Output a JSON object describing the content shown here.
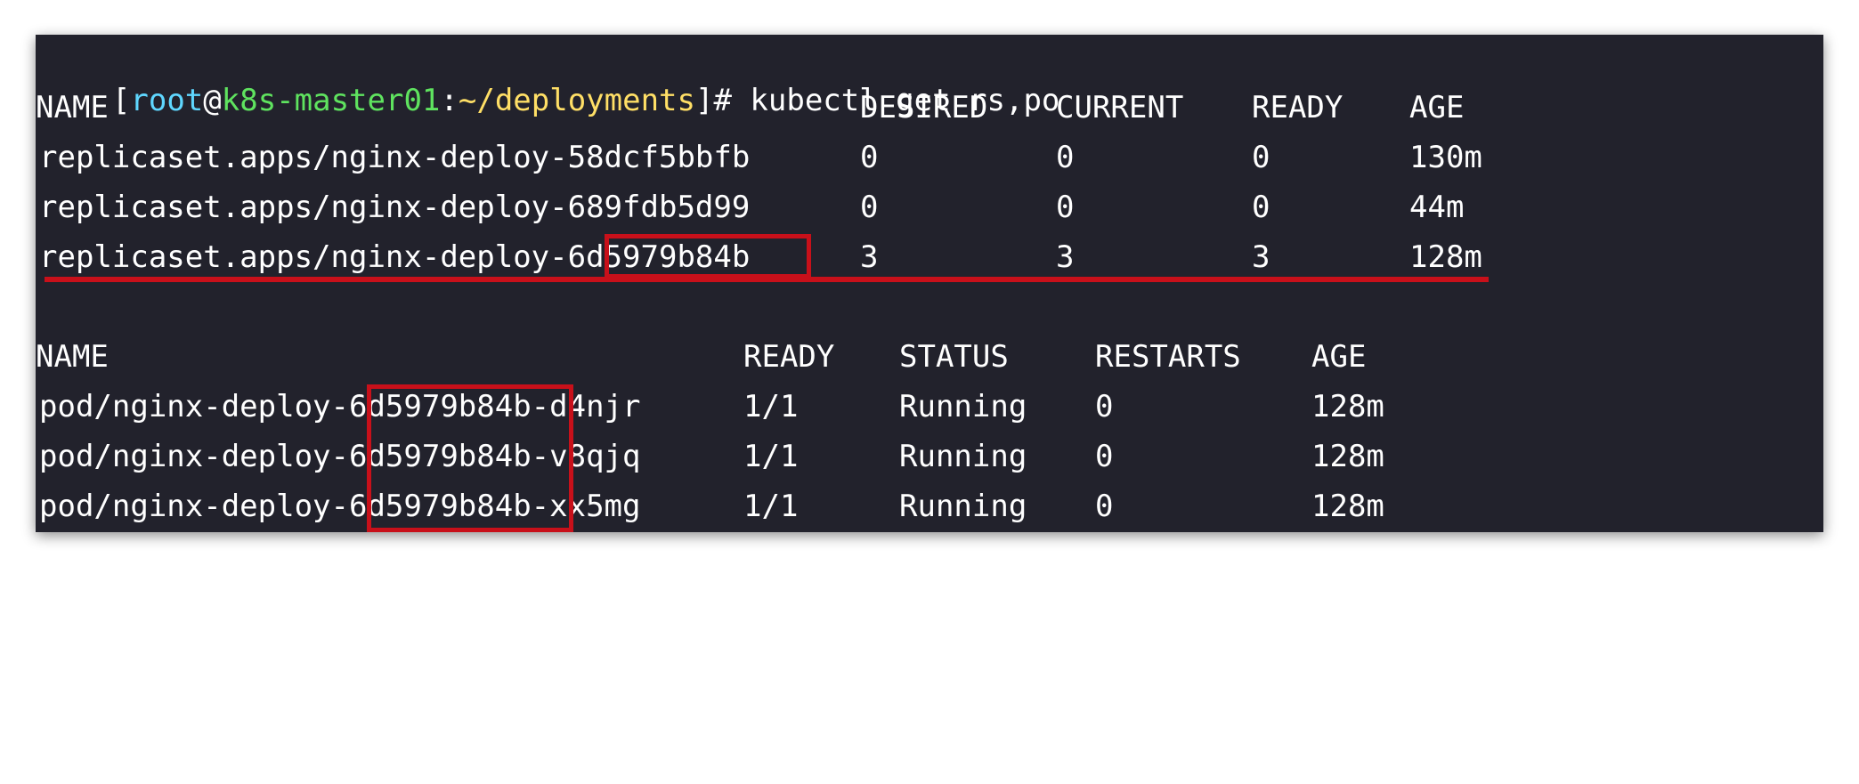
{
  "prompt": {
    "open_bracket": "[",
    "user": "root",
    "at": "@",
    "host": "k8s-master01",
    "colon": ":",
    "path": "~/deployments",
    "close": "]#",
    "command": " kubectl get rs,po"
  },
  "rs_table": {
    "headers": [
      "NAME",
      "DESIRED",
      "CURRENT",
      "READY",
      "AGE"
    ],
    "rows": [
      {
        "name": "replicaset.apps/nginx-deploy-58dcf5bbfb",
        "desired": "0",
        "current": "0",
        "ready": "0",
        "age": "130m"
      },
      {
        "name": "replicaset.apps/nginx-deploy-689fdb5d99",
        "desired": "0",
        "current": "0",
        "ready": "0",
        "age": "44m"
      },
      {
        "name": "replicaset.apps/nginx-deploy-6d5979b84b",
        "desired": "3",
        "current": "3",
        "ready": "3",
        "age": "128m"
      }
    ]
  },
  "pod_table": {
    "headers": [
      "NAME",
      "READY",
      "STATUS",
      "RESTARTS",
      "AGE"
    ],
    "rows": [
      {
        "name": "pod/nginx-deploy-6d5979b84b-d4njr",
        "ready": "1/1",
        "status": "Running",
        "restarts": "0",
        "age": "128m"
      },
      {
        "name": "pod/nginx-deploy-6d5979b84b-v8qjq",
        "ready": "1/1",
        "status": "Running",
        "restarts": "0",
        "age": "128m"
      },
      {
        "name": "pod/nginx-deploy-6d5979b84b-xx5mg",
        "ready": "1/1",
        "status": "Running",
        "restarts": "0",
        "age": "128m"
      }
    ]
  },
  "highlight": {
    "color": "#c8101a"
  }
}
